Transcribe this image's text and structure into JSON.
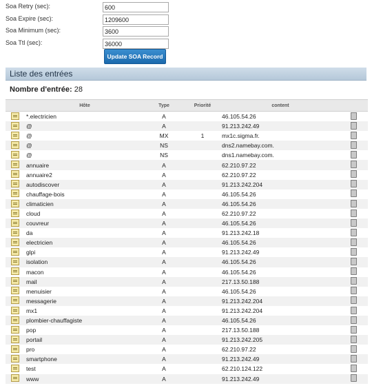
{
  "soa": {
    "fields": [
      {
        "label": "Soa Retry (sec):",
        "value": "600"
      },
      {
        "label": "Soa Expire (sec):",
        "value": "1209600"
      },
      {
        "label": "Soa Minimum (sec):",
        "value": "3600"
      },
      {
        "label": "Soa Ttl (sec):",
        "value": "36000"
      }
    ],
    "button_label": "Update SOA Record"
  },
  "list": {
    "title": "Liste des entrées",
    "count_label": "Nombre d'entrée:",
    "count_value": "28",
    "headers": {
      "host": "Hôte",
      "type": "Type",
      "priority": "Priorité",
      "content": "content"
    },
    "records": [
      {
        "host": "*.electricien",
        "type": "A",
        "priority": "",
        "content": "46.105.54.26"
      },
      {
        "host": "@",
        "type": "A",
        "priority": "",
        "content": "91.213.242.49"
      },
      {
        "host": "@",
        "type": "MX",
        "priority": "1",
        "content": "mx1c.sigma.fr."
      },
      {
        "host": "@",
        "type": "NS",
        "priority": "",
        "content": "dns2.namebay.com."
      },
      {
        "host": "@",
        "type": "NS",
        "priority": "",
        "content": "dns1.namebay.com."
      },
      {
        "host": "annuaire",
        "type": "A",
        "priority": "",
        "content": "62.210.97.22"
      },
      {
        "host": "annuaire2",
        "type": "A",
        "priority": "",
        "content": "62.210.97.22"
      },
      {
        "host": "autodiscover",
        "type": "A",
        "priority": "",
        "content": "91.213.242.204"
      },
      {
        "host": "chauffage-bois",
        "type": "A",
        "priority": "",
        "content": "46.105.54.26"
      },
      {
        "host": "climaticien",
        "type": "A",
        "priority": "",
        "content": "46.105.54.26"
      },
      {
        "host": "cloud",
        "type": "A",
        "priority": "",
        "content": "62.210.97.22"
      },
      {
        "host": "couvreur",
        "type": "A",
        "priority": "",
        "content": "46.105.54.26"
      },
      {
        "host": "da",
        "type": "A",
        "priority": "",
        "content": "91.213.242.18"
      },
      {
        "host": "electricien",
        "type": "A",
        "priority": "",
        "content": "46.105.54.26"
      },
      {
        "host": "glpi",
        "type": "A",
        "priority": "",
        "content": "91.213.242.49"
      },
      {
        "host": "isolation",
        "type": "A",
        "priority": "",
        "content": "46.105.54.26"
      },
      {
        "host": "macon",
        "type": "A",
        "priority": "",
        "content": "46.105.54.26"
      },
      {
        "host": "mail",
        "type": "A",
        "priority": "",
        "content": "217.13.50.188"
      },
      {
        "host": "menuisier",
        "type": "A",
        "priority": "",
        "content": "46.105.54.26"
      },
      {
        "host": "messagerie",
        "type": "A",
        "priority": "",
        "content": "91.213.242.204"
      },
      {
        "host": "mx1",
        "type": "A",
        "priority": "",
        "content": "91.213.242.204"
      },
      {
        "host": "plombier-chauffagiste",
        "type": "A",
        "priority": "",
        "content": "46.105.54.26"
      },
      {
        "host": "pop",
        "type": "A",
        "priority": "",
        "content": "217.13.50.188"
      },
      {
        "host": "portail",
        "type": "A",
        "priority": "",
        "content": "91.213.242.205"
      },
      {
        "host": "pro",
        "type": "A",
        "priority": "",
        "content": "62.210.97.22"
      },
      {
        "host": "smartphone",
        "type": "A",
        "priority": "",
        "content": "91.213.242.49"
      },
      {
        "host": "test",
        "type": "A",
        "priority": "",
        "content": "62.210.124.122"
      },
      {
        "host": "www",
        "type": "A",
        "priority": "",
        "content": "91.213.242.49"
      }
    ]
  },
  "icons": {
    "edit": "edit-record-icon",
    "delete": "trash-icon"
  }
}
